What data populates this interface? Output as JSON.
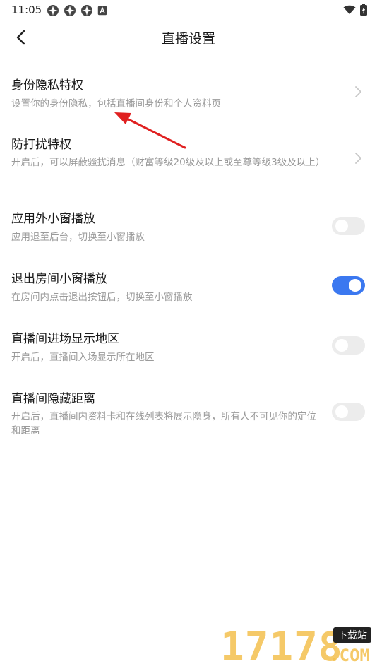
{
  "status_bar": {
    "time": "11:05",
    "left_icons": [
      "app-notification-icon",
      "app-notification-icon",
      "app-notification-icon",
      "font-a-icon"
    ],
    "right_icons": [
      "wifi-icon",
      "battery-charging-icon"
    ]
  },
  "nav": {
    "back_icon": "chevron-left-icon",
    "title": "直播设置"
  },
  "settings": [
    {
      "title": "身份隐私特权",
      "desc": "设置你的身份隐私，包括直播间身份和个人资料页",
      "control": "chevron"
    },
    {
      "title": "防打扰特权",
      "desc": "开启后，可以屏蔽骚扰消息（财富等级20级及以上或至尊等级3级及以上）",
      "control": "chevron"
    },
    {
      "title": "应用外小窗播放",
      "desc": "应用退至后台，切换至小窗播放",
      "control": "toggle",
      "on": false
    },
    {
      "title": "退出房间小窗播放",
      "desc": "在房间内点击退出按钮后，切换至小窗播放",
      "control": "toggle",
      "on": true
    },
    {
      "title": "直播间进场显示地区",
      "desc": "开启后，直播间入场显示所在地区",
      "control": "toggle",
      "on": false
    },
    {
      "title": "直播间隐藏距离",
      "desc": "开启后，直播间内资料卡和在线列表将展示隐身，所有人不可见你的定位和距离",
      "control": "toggle",
      "on": false
    }
  ],
  "colors": {
    "toggle_on": "#3b78f0",
    "toggle_off": "#ececec",
    "annotation_arrow": "#e02020"
  },
  "watermark": {
    "digits": "17178",
    "tag": "下载站",
    "suffix": ".COM"
  }
}
